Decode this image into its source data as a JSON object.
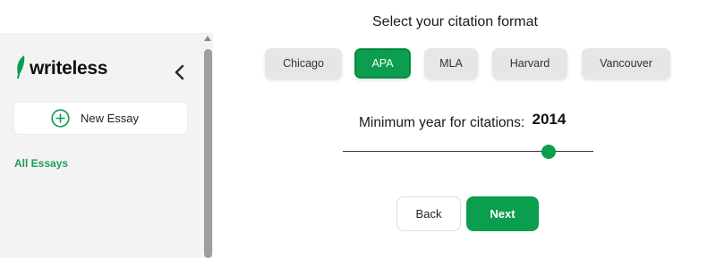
{
  "sidebar": {
    "brand": "writeless",
    "new_essay_label": "New Essay",
    "nav_all_essays": "All Essays"
  },
  "citation": {
    "heading": "Select your citation format",
    "formats": [
      "Chicago",
      "APA",
      "MLA",
      "Harvard",
      "Vancouver"
    ],
    "selected": "APA",
    "year_label": "Minimum year for citations:",
    "year_value": "2014"
  },
  "actions": {
    "back": "Back",
    "next": "Next"
  },
  "colors": {
    "accent": "#0a9e4e",
    "sidebar_bg": "#f3f3f3",
    "button_bg": "#e6e6e6"
  },
  "icons": {
    "brand": "feather-leaf-icon",
    "collapse": "chevron-left-icon",
    "new_essay": "plus-circle-icon"
  }
}
